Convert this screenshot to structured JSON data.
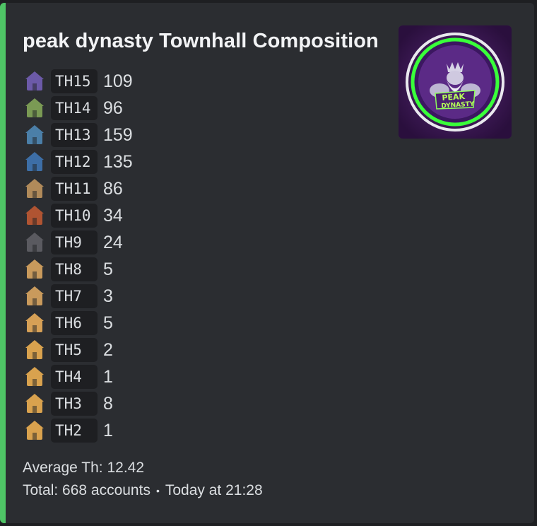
{
  "embed": {
    "title": "peak dynasty Townhall Composition",
    "accent_color": "#4fc566",
    "thumbnail": {
      "icon": "peak-dynasty-logo",
      "text_line1": "PEAK",
      "text_line2": "DYNASTY"
    },
    "rows": [
      {
        "icon": "th15-icon",
        "label": "TH15",
        "count": "109"
      },
      {
        "icon": "th14-icon",
        "label": "TH14",
        "count": "96"
      },
      {
        "icon": "th13-icon",
        "label": "TH13",
        "count": "159"
      },
      {
        "icon": "th12-icon",
        "label": "TH12",
        "count": "135"
      },
      {
        "icon": "th11-icon",
        "label": "TH11",
        "count": "86"
      },
      {
        "icon": "th10-icon",
        "label": "TH10",
        "count": "34"
      },
      {
        "icon": "th9-icon",
        "label": "TH9",
        "count": "24"
      },
      {
        "icon": "th8-icon",
        "label": "TH8",
        "count": "5"
      },
      {
        "icon": "th7-icon",
        "label": "TH7",
        "count": "3"
      },
      {
        "icon": "th6-icon",
        "label": "TH6",
        "count": "5"
      },
      {
        "icon": "th5-icon",
        "label": "TH5",
        "count": "2"
      },
      {
        "icon": "th4-icon",
        "label": "TH4",
        "count": "1"
      },
      {
        "icon": "th3-icon",
        "label": "TH3",
        "count": "8"
      },
      {
        "icon": "th2-icon",
        "label": "TH2",
        "count": "1"
      }
    ],
    "average": "Average Th: 12.42",
    "footer_total": "Total: 668 accounts",
    "footer_separator": "•",
    "footer_time": "Today at 21:28",
    "row_colors": [
      "#6c5aa8",
      "#7a9a54",
      "#4b7fa8",
      "#3d6ea6",
      "#b08a5a",
      "#b05432",
      "#5a5a60",
      "#c99a5c",
      "#c99a5c",
      "#d6a056",
      "#d9a24e",
      "#d9a24e",
      "#d9a24e",
      "#d9a24e"
    ]
  }
}
